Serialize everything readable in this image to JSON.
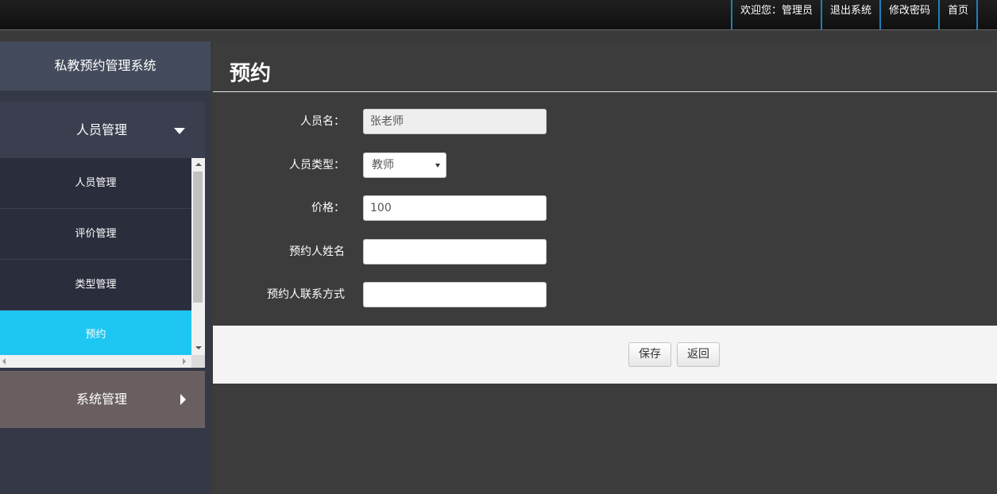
{
  "topnav": {
    "items": [
      {
        "label": "欢迎您：管理员"
      },
      {
        "label": "退出系统"
      },
      {
        "label": "修改密码"
      },
      {
        "label": "首页"
      }
    ]
  },
  "sidebar": {
    "brand": "私教预约管理系统",
    "groups": [
      {
        "label": "人员管理",
        "expanded": true,
        "icon": "chevron-down-icon"
      },
      {
        "label": "系统管理",
        "expanded": false,
        "icon": "chevron-right-icon"
      }
    ],
    "submenu": [
      {
        "label": "人员管理"
      },
      {
        "label": "评价管理"
      },
      {
        "label": "类型管理"
      },
      {
        "label": "预约",
        "active": true
      }
    ]
  },
  "main": {
    "title": "预约",
    "form": {
      "name_label": "人员名：",
      "name_value": "张老师",
      "type_label": "人员类型：",
      "type_value": "教师",
      "price_label": "价格：",
      "price_value": "100",
      "booker_name_label": "预约人姓名",
      "booker_name_value": "",
      "booker_contact_label": "预约人联系方式",
      "booker_contact_value": ""
    },
    "actions": {
      "save_label": "保存",
      "back_label": "返回"
    }
  },
  "colors": {
    "active_menu": "#1ec6f2",
    "topnav_divider": "#1e7fb8",
    "system_group": "#6a5f60"
  }
}
